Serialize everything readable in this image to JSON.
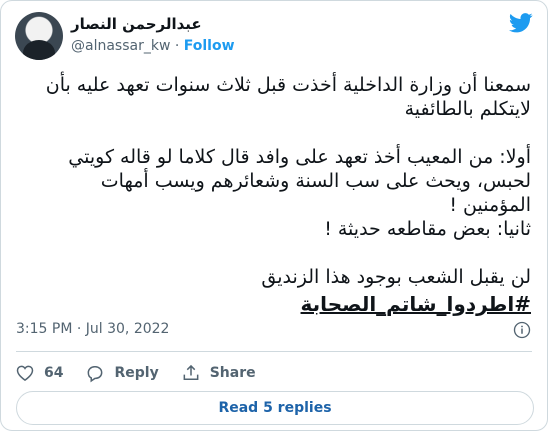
{
  "author": {
    "display_name": "عبدالرحمن النصار",
    "handle": "@alnassar_kw",
    "separator": "·",
    "follow_label": "Follow"
  },
  "tweet": {
    "text": "سمعنا أن وزارة الداخلية أخذت قبل ثلاث سنوات تعهد عليه بأن\nلايتكلم بالطائفية\n\nأولا: من المعيب أخذ تعهد على وافد قال كلاما لو قاله كويتي\nلحبس، ويحث على سب السنة وشعائرهم ويسب أمهات\nالمؤمنين !\nثانيا: بعض مقاطعه حديثة !\n\nلن يقبل الشعب بوجود هذا الزنديق",
    "hashtag": "#اطردوا_شاتم_الصحابة",
    "timestamp": "3:15 PM · Jul 30, 2022"
  },
  "actions": {
    "like_count": "64",
    "reply_label": "Reply",
    "share_label": "Share"
  },
  "footer": {
    "read_replies_label": "Read 5 replies"
  },
  "colors": {
    "accent": "#1d9bf0",
    "like_red": "#f91880",
    "text_primary": "#0f1419",
    "text_secondary": "#536471",
    "border": "#cfd9de"
  },
  "icons": [
    "twitter-bird-icon",
    "info-icon",
    "heart-icon",
    "reply-icon",
    "share-icon"
  ]
}
